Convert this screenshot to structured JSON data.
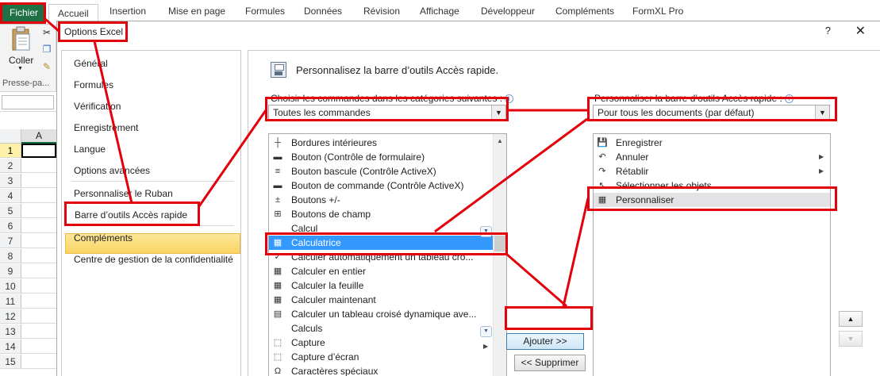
{
  "ribbon": {
    "file_tab": "Fichier",
    "tabs": [
      "Accueil",
      "Insertion",
      "Mise en page",
      "Formules",
      "Données",
      "Révision",
      "Affichage",
      "Développeur",
      "Compléments",
      "FormXL Pro"
    ],
    "paste_label": "Coller",
    "clipboard_group": "Presse-pa..."
  },
  "sheet": {
    "column": "A",
    "rows": [
      "1",
      "2",
      "3",
      "4",
      "5",
      "6",
      "7",
      "8",
      "9",
      "10",
      "11",
      "12",
      "13",
      "14",
      "15"
    ]
  },
  "dialog": {
    "title": "Options Excel",
    "help": "?",
    "close": "✕",
    "nav": [
      "Général",
      "Formules",
      "Vérification",
      "Enregistrement",
      "Langue",
      "Options avancées",
      "Personnaliser le Ruban",
      "Barre d’outils Accès rapide",
      "Compléments",
      "Centre de gestion de la confidentialité"
    ],
    "heading": "Personnalisez la barre d’outils Accès rapide.",
    "choose_label": "Choisir les commandes dans les catégories suivantes :",
    "choose_value": "Toutes les commandes",
    "customize_label": "Personnaliser la barre d’outils Accès rapide :",
    "customize_value": "Pour tous les documents (par défaut)",
    "commands": [
      {
        "label": "Bordures intérieures",
        "icon": "┼"
      },
      {
        "label": "Bouton (Contrôle de formulaire)",
        "icon": "▬"
      },
      {
        "label": "Bouton bascule (Contrôle ActiveX)",
        "icon": "≡"
      },
      {
        "label": "Bouton de commande (Contrôle ActiveX)",
        "icon": "▬"
      },
      {
        "label": "Boutons +/-",
        "icon": "±"
      },
      {
        "label": "Boutons de champ",
        "icon": "⊞"
      },
      {
        "label": "Calcul",
        "icon": ""
      },
      {
        "label": "Calculatrice",
        "icon": "▦"
      },
      {
        "label": "Calculer automatiquement un tableau cro...",
        "icon": "✓"
      },
      {
        "label": "Calculer en entier",
        "icon": "▦"
      },
      {
        "label": "Calculer la feuille",
        "icon": "▦"
      },
      {
        "label": "Calculer maintenant",
        "icon": "▦"
      },
      {
        "label": "Calculer un tableau croisé dynamique ave...",
        "icon": "▤"
      },
      {
        "label": "Calculs",
        "icon": ""
      },
      {
        "label": "Capture",
        "icon": "⬚"
      },
      {
        "label": "Capture d’écran",
        "icon": "⬚"
      },
      {
        "label": "Caractères spéciaux",
        "icon": "Ω"
      }
    ],
    "qat_items": [
      {
        "label": "Enregistrer",
        "icon": "💾"
      },
      {
        "label": "Annuler",
        "icon": "↶"
      },
      {
        "label": "Rétablir",
        "icon": "↷"
      },
      {
        "label": "Sélectionner les objets",
        "icon": "↖"
      },
      {
        "label": "Personnaliser",
        "icon": "▦"
      }
    ],
    "add_button": "Ajouter >>",
    "remove_button": "<< Supprimer",
    "move_up": "▲",
    "move_down": "▼"
  }
}
